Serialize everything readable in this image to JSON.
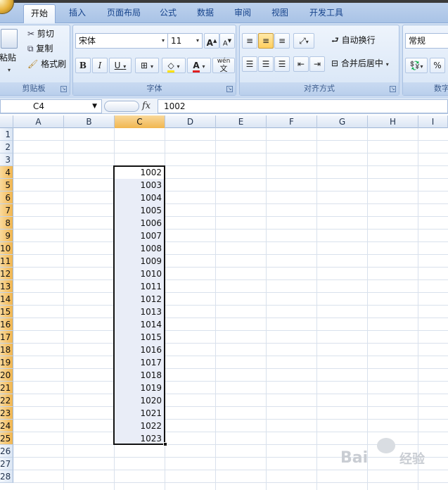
{
  "ribbon": {
    "tabs": [
      "开始",
      "插入",
      "页面布局",
      "公式",
      "数据",
      "审阅",
      "视图",
      "开发工具"
    ],
    "active_tab": "开始",
    "clipboard": {
      "paste": "粘贴",
      "cut": "剪切",
      "copy": "复制",
      "format_painter": "格式刷",
      "group_label": "剪贴板"
    },
    "font": {
      "font_name": "宋体",
      "font_size": "11",
      "bold": "B",
      "italic": "I",
      "underline": "U",
      "font_color_glyph": "A",
      "grow": "A",
      "shrink": "A",
      "phonetic": "wén",
      "phonetic_glyph": "文",
      "group_label": "字体"
    },
    "alignment": {
      "wrap_text": "自动换行",
      "merge_center": "合并后居中",
      "group_label": "对齐方式"
    },
    "number": {
      "format": "常规",
      "percent": "%",
      "group_label": "数字"
    }
  },
  "formula_bar": {
    "name_box": "C4",
    "fx": "fx",
    "value": "1002"
  },
  "columns": [
    "A",
    "B",
    "C",
    "D",
    "E",
    "F",
    "G",
    "H",
    "I"
  ],
  "selected_column": "C",
  "rows": [
    "1",
    "2",
    "3",
    "4",
    "5",
    "6",
    "7",
    "8",
    "9",
    "10",
    "11",
    "12",
    "13",
    "14",
    "15",
    "16",
    "17",
    "18",
    "19",
    "20",
    "21",
    "22",
    "23",
    "24",
    "25",
    "26",
    "27",
    "28"
  ],
  "selected_rows": [
    "4",
    "5",
    "6",
    "7",
    "8",
    "9",
    "10",
    "11",
    "12",
    "13",
    "14",
    "15",
    "16",
    "17",
    "18",
    "19",
    "20",
    "21",
    "22",
    "23",
    "24",
    "25"
  ],
  "cells_c": [
    "1002",
    "1003",
    "1004",
    "1005",
    "1006",
    "1007",
    "1008",
    "1009",
    "1010",
    "1011",
    "1012",
    "1013",
    "1014",
    "1015",
    "1016",
    "1017",
    "1018",
    "1019",
    "1020",
    "1021",
    "1022",
    "1023"
  ],
  "watermark": {
    "brand": "Bai",
    "brand_suffix": "经验"
  }
}
